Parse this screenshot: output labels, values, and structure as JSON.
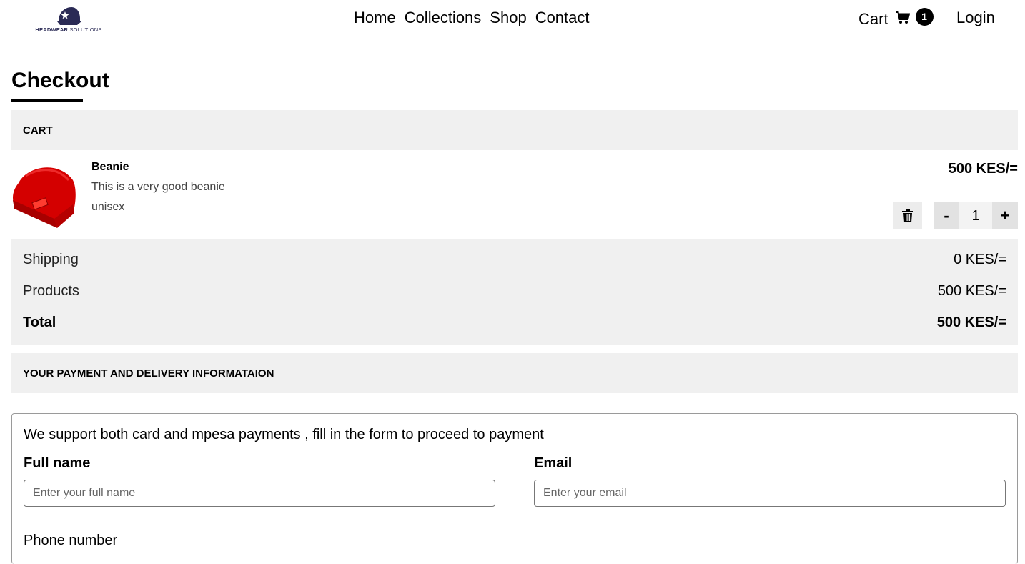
{
  "header": {
    "logo": {
      "brand_strong": "HEADWEAR",
      "brand_light": "SOLUTIONS",
      "icon": "cap-logo-icon"
    },
    "nav": [
      {
        "label": "Home"
      },
      {
        "label": "Collections"
      },
      {
        "label": "Shop"
      },
      {
        "label": "Contact"
      }
    ],
    "cart": {
      "label": "Cart",
      "icon": "shopping-cart-icon",
      "count": "1"
    },
    "login_label": "Login"
  },
  "page": {
    "title": "Checkout"
  },
  "cart_section": {
    "heading": "CART",
    "items": [
      {
        "name": "Beanie",
        "description": "This is a very good beanie",
        "tag": "unisex",
        "price": "500 KES/=",
        "quantity": "1",
        "image_icon": "red-beanie-image",
        "delete_icon": "trash-icon",
        "decrement_label": "-",
        "increment_label": "+"
      }
    ]
  },
  "summary": {
    "shipping": {
      "label": "Shipping",
      "value": "0 KES/="
    },
    "products": {
      "label": "Products",
      "value": "500 KES/="
    },
    "total": {
      "label": "Total",
      "value": "500 KES/="
    }
  },
  "payment_section": {
    "heading": "YOUR PAYMENT AND DELIVERY INFORMATAION",
    "intro": "We support both card and mpesa payments , fill in the form to proceed to payment",
    "full_name": {
      "label": "Full name",
      "placeholder": "Enter your full name",
      "value": ""
    },
    "email": {
      "label": "Email",
      "placeholder": "Enter your email",
      "value": ""
    },
    "phone": {
      "label": "Phone number"
    }
  },
  "colors": {
    "section_bg": "#f0f0f0",
    "brand": "#2a2a55",
    "beanie": "#d40000"
  }
}
